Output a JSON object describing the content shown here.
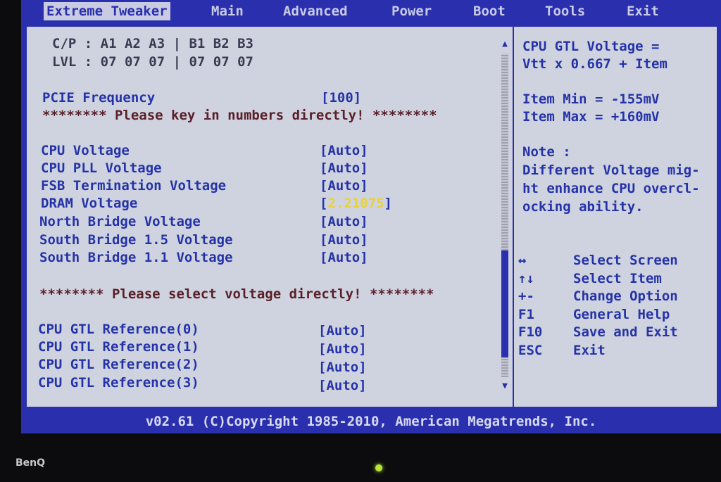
{
  "menu": {
    "tabs": [
      {
        "label": "Extreme Tweaker"
      },
      {
        "label": "Main"
      },
      {
        "label": "Advanced"
      },
      {
        "label": "Power"
      },
      {
        "label": "Boot"
      },
      {
        "label": "Tools"
      },
      {
        "label": "Exit"
      }
    ]
  },
  "cp_line": "C/P : A1 A2 A3 | B1 B2 B3",
  "lvl_line": "LVL : 07 07 07 | 07 07 07",
  "pcie": {
    "label": "PCIE Frequency",
    "value": "[100]"
  },
  "notice_numbers": "******** Please key in numbers directly! ********",
  "voltages": [
    {
      "label": "CPU Voltage",
      "value": "[Auto]"
    },
    {
      "label": "CPU PLL Voltage",
      "value": "[Auto]"
    },
    {
      "label": "FSB Termination Voltage",
      "value": "[Auto]"
    },
    {
      "label": "DRAM Voltage",
      "value_open": "[",
      "value_sel": "2.21075",
      "value_close": "]"
    },
    {
      "label": "North Bridge Voltage",
      "value": "[Auto]"
    },
    {
      "label": "South Bridge 1.5 Voltage",
      "value": "[Auto]"
    },
    {
      "label": "South Bridge 1.1 Voltage",
      "value": "[Auto]"
    }
  ],
  "notice_select": "******** Please select voltage directly! ********",
  "gtl": [
    {
      "label": "CPU GTL Reference(0)",
      "value": "[Auto]"
    },
    {
      "label": "CPU GTL Reference(1)",
      "value": "[Auto]"
    },
    {
      "label": "CPU GTL Reference(2)",
      "value": "[Auto]"
    },
    {
      "label": "CPU GTL Reference(3)",
      "value": "[Auto]"
    }
  ],
  "help": {
    "lines": [
      "CPU GTL Voltage =",
      "Vtt x 0.667 + Item",
      "",
      "Item Min = -155mV",
      "Item Max = +160mV",
      "",
      "Note :",
      "Different Voltage mig-",
      "ht enhance CPU overcl-",
      "ocking ability."
    ]
  },
  "keys": [
    {
      "key": "↔",
      "desc": "Select Screen"
    },
    {
      "key": "↑↓",
      "desc": "Select Item"
    },
    {
      "key": "+-",
      "desc": "Change Option"
    },
    {
      "key": "F1",
      "desc": "General Help"
    },
    {
      "key": "F10",
      "desc": "Save and Exit"
    },
    {
      "key": "ESC",
      "desc": "Exit"
    }
  ],
  "footer": "v02.61 (C)Copyright 1985-2010, American Megatrends, Inc.",
  "bezel_brand": "BenQ",
  "colors": {
    "bios_blue": "#2a2fae",
    "panel_gray": "#cfd3df",
    "highlight_yellow": "#e8d23a"
  }
}
